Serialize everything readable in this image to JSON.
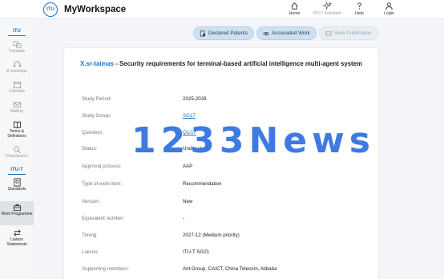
{
  "header": {
    "app_title": "MyWorkspace",
    "logo_text": "ITU",
    "nav": [
      {
        "label": "Home",
        "icon": "home-icon"
      },
      {
        "label": "ITU-T Assistant",
        "icon": "sparkle-icon"
      },
      {
        "label": "Help",
        "icon": "question-icon"
      },
      {
        "label": "Login",
        "icon": "user-icon"
      }
    ]
  },
  "sidebar": {
    "section_itu": "ITU",
    "section_itut": "ITU-T",
    "items": [
      {
        "label": "Translate",
        "icon": "translate-icon"
      },
      {
        "label": "E-meetings",
        "icon": "headset-icon"
      },
      {
        "label": "Calendar",
        "icon": "calendar-icon"
      },
      {
        "label": "Mailing",
        "icon": "mail-icon"
      },
      {
        "label": "Terms & Definitions",
        "icon": "book-icon"
      },
      {
        "label": "DeepSearch",
        "icon": "search-icon"
      },
      {
        "label": "Standards",
        "icon": "standards-icon"
      },
      {
        "label": "Work Programme",
        "icon": "briefcase-icon"
      },
      {
        "label": "Liaison Statements",
        "icon": "exchange-icon"
      }
    ]
  },
  "tabs": [
    {
      "label": "Declared Patents",
      "icon": "patent-icon"
    },
    {
      "label": "Associated Work",
      "icon": "link-icon"
    },
    {
      "label": "View Publication",
      "icon": "publication-icon"
    }
  ],
  "work_item": {
    "code": "X.sr-taimas",
    "title_rest": " - Security requirements for terminal-based artificial intelligence multi-agent system",
    "fields": [
      {
        "label": "Study Period:",
        "value": "2025-2028"
      },
      {
        "label": "Study Group:",
        "value": "SG17"
      },
      {
        "label": "Question:",
        "value": "Q1/17"
      },
      {
        "label": "Status:",
        "value": "Under study"
      },
      {
        "label": "Approval process:",
        "value": "AAP"
      },
      {
        "label": "Type of work item:",
        "value": "Recommendation"
      },
      {
        "label": "Version:",
        "value": "New"
      },
      {
        "label": "Equivalent number:",
        "value": "-"
      },
      {
        "label": "Timing:",
        "value": "2027-12 (Medium priority)"
      },
      {
        "label": "Liaison:",
        "value": "ITU-T SG21"
      },
      {
        "label": "Supporting members:",
        "value": "Ant Group, CAICT, China Telecom, Alibaba"
      }
    ]
  },
  "watermark": "1233News",
  "colors": {
    "accent": "#1a73c9",
    "watermark": "#2d6fe0"
  }
}
